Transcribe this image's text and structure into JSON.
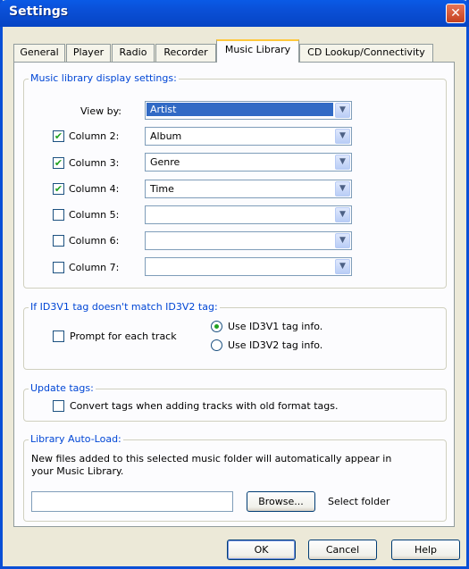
{
  "window": {
    "title": "Settings",
    "close_glyph": "✕"
  },
  "tabs": [
    {
      "label": "General"
    },
    {
      "label": "Player"
    },
    {
      "label": "Radio"
    },
    {
      "label": "Recorder"
    },
    {
      "label": "Music Library",
      "active": true
    },
    {
      "label": "CD Lookup/Connectivity"
    }
  ],
  "display": {
    "legend": "Music library display settings:",
    "view_by_label": "View by:",
    "view_by_value": "Artist",
    "columns": [
      {
        "label": "Column 2:",
        "checked": true,
        "value": "Album"
      },
      {
        "label": "Column 3:",
        "checked": true,
        "value": "Genre"
      },
      {
        "label": "Column 4:",
        "checked": true,
        "value": "Time"
      },
      {
        "label": "Column 5:",
        "checked": false,
        "value": ""
      },
      {
        "label": "Column 6:",
        "checked": false,
        "value": ""
      },
      {
        "label": "Column 7:",
        "checked": false,
        "value": ""
      }
    ]
  },
  "id3": {
    "legend": "If ID3V1 tag doesn't match ID3V2 tag:",
    "prompt_label": "Prompt for each track",
    "prompt_checked": false,
    "options": [
      {
        "label": "Use ID3V1 tag info.",
        "selected": true
      },
      {
        "label": "Use ID3V2 tag info.",
        "selected": false
      }
    ]
  },
  "update_tags": {
    "legend": "Update tags:",
    "convert_label": "Convert tags when adding tracks with old format tags.",
    "convert_checked": false
  },
  "auto_load": {
    "legend": "Library Auto-Load:",
    "description_line1": "New files added to this selected music folder will automatically appear in",
    "description_line2": "your Music Library.",
    "folder_value": "",
    "browse_label": "Browse...",
    "select_folder_label": "Select folder"
  },
  "footer": {
    "ok_label": "OK",
    "cancel_label": "Cancel",
    "help_label": "Help"
  },
  "icons": {
    "check": "✔",
    "dropdown": "▼"
  }
}
